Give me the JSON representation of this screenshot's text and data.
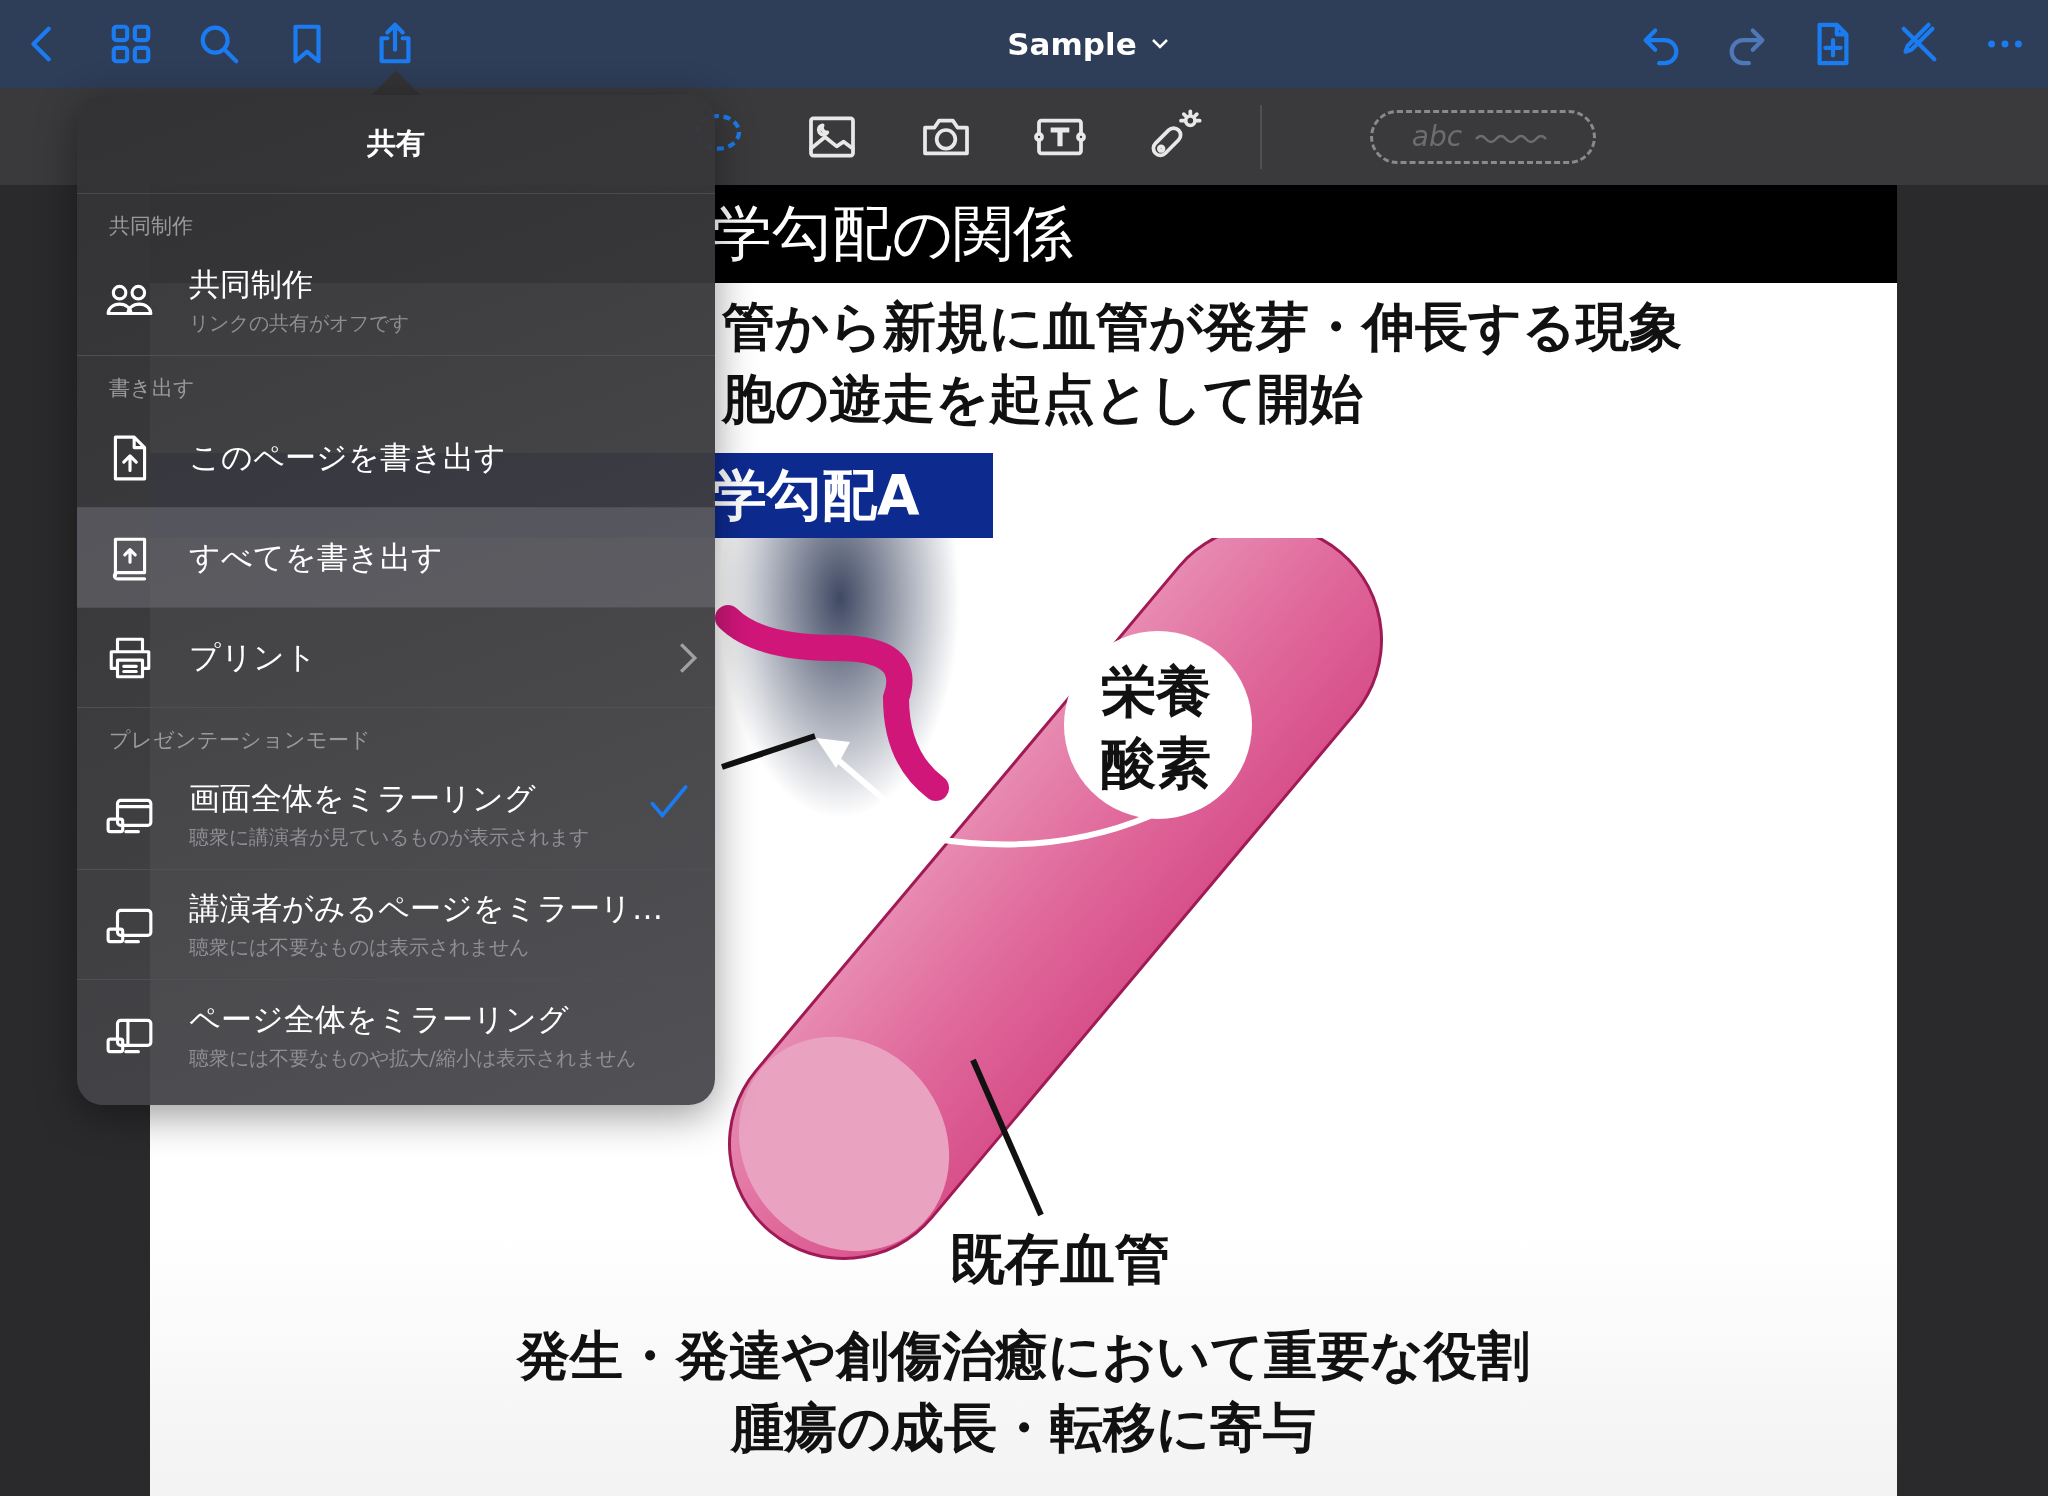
{
  "nav": {
    "title": "Sample"
  },
  "toolbar": {
    "pen_style_label": "abc"
  },
  "slide": {
    "header": "学勾配の関係",
    "bullets": [
      "管から新規に血管が発芽・伸長する現象",
      "胞の遊走を起点として開始"
    ],
    "label_box": "学勾配A",
    "diagram": {
      "bubble_lines": [
        "栄養",
        "酸素"
      ],
      "vessel_label": "既存血管"
    },
    "footer_lines": [
      "発生・発達や創傷治癒において重要な役割",
      "腫瘍の成長・転移に寄与"
    ]
  },
  "share_popover": {
    "title": "共有",
    "sections": [
      {
        "header": "共同制作",
        "items": [
          {
            "kind": "people",
            "label": "共同制作",
            "subtitle": "リンクの共有がオフです",
            "highlighted": false,
            "submenu": false,
            "checked": false
          }
        ]
      },
      {
        "header": "書き出す",
        "items": [
          {
            "kind": "page-export",
            "label": "このページを書き出す",
            "highlighted": false,
            "submenu": false,
            "checked": false
          },
          {
            "kind": "book-export",
            "label": "すべてを書き出す",
            "highlighted": true,
            "submenu": false,
            "checked": false
          },
          {
            "kind": "printer",
            "label": "プリント",
            "highlighted": false,
            "submenu": true,
            "checked": false
          }
        ]
      },
      {
        "header": "プレゼンテーションモード",
        "items": [
          {
            "kind": "screen-full",
            "label": "画面全体をミラーリング",
            "subtitle": "聴衆に講演者が見ているものが表示されます",
            "highlighted": false,
            "submenu": false,
            "checked": true
          },
          {
            "kind": "screen-presenter",
            "label": "講演者がみるページをミラーリ…",
            "subtitle": "聴衆には不要なものは表示されません",
            "highlighted": false,
            "submenu": false,
            "checked": false
          },
          {
            "kind": "screen-page",
            "label": "ページ全体をミラーリング",
            "subtitle": "聴衆には不要なものや拡大/縮小は表示されません",
            "highlighted": false,
            "submenu": false,
            "checked": false
          }
        ]
      }
    ]
  }
}
